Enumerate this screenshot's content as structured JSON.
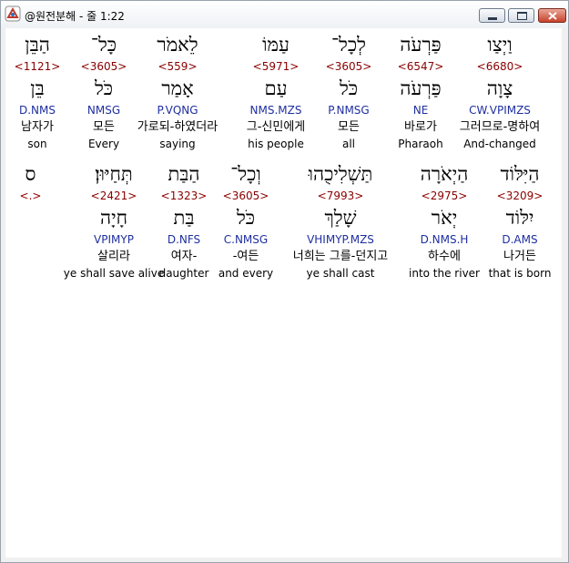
{
  "window": {
    "title": "@원전분해 - 줄 1:22"
  },
  "rows": [
    {
      "words": [
        {
          "original": "הַבֵּן",
          "strong": "<1121>",
          "lemma": "בֵּן",
          "morph": "D.NMS",
          "korean": "남자가",
          "english": "son"
        },
        {
          "original": "כָּל־",
          "strong": "<3605>",
          "lemma": "כֹּל",
          "morph": "NMSG",
          "korean": "모든",
          "english": "Every"
        },
        {
          "original": "לֵאמֹר",
          "strong": "<559>",
          "lemma": "אָמַר",
          "morph": "P.VQNG",
          "korean": "가로되-하였더라",
          "english": "saying"
        },
        {
          "original": "עַמּוֹ",
          "strong": "<5971>",
          "lemma": "עַם",
          "morph": "NMS.MZS",
          "korean": "그-신민에게",
          "english": "his people"
        },
        {
          "original": "לְכָל־",
          "strong": "<3605>",
          "lemma": "כֹּל",
          "morph": "P.NMSG",
          "korean": "모든",
          "english": "all"
        },
        {
          "original": "פַּרְעֹה",
          "strong": "<6547>",
          "lemma": "פַּרְעֹה",
          "morph": "NE",
          "korean": "바로가",
          "english": "Pharaoh"
        },
        {
          "original": "וַיְצַו",
          "strong": "<6680>",
          "lemma": "צָוָה",
          "morph": "CW.VPIMZS",
          "korean": "그러므로-명하여",
          "english": "And-changed"
        }
      ]
    },
    {
      "words": [
        {
          "original": "ס",
          "strong": "<.>",
          "lemma": "",
          "morph": "",
          "korean": "",
          "english": ""
        },
        {
          "original": "תְּחַיּוּן׃",
          "strong": "<2421>",
          "lemma": "חָיָה",
          "morph": "VPIMYP",
          "korean": "살리라",
          "english": "ye shall save alive"
        },
        {
          "original": "הַבַּת",
          "strong": "<1323>",
          "lemma": "בַּת",
          "morph": "D.NFS",
          "korean": "여자-",
          "english": "daughter"
        },
        {
          "original": "וְכָל־",
          "strong": "<3605>",
          "lemma": "כֹּל",
          "morph": "C.NMSG",
          "korean": "-여든",
          "english": "and every"
        },
        {
          "original": "תַּשְׁלִיכֻהוּ",
          "strong": "<7993>",
          "lemma": "שָׁלַךְ",
          "morph": "VHIMYP.MZS",
          "korean": "너희는 그를-던지고",
          "english": "ye shall cast"
        },
        {
          "original": "הַיְאֹרָה",
          "strong": "<2975>",
          "lemma": "יְאֹר",
          "morph": "D.NMS.H",
          "korean": "하수에",
          "english": "into the river"
        },
        {
          "original": "הַיִּלּוֹד",
          "strong": "<3209>",
          "lemma": "יִלּוֹד",
          "morph": "D.AMS",
          "korean": "나거든",
          "english": "that is born"
        }
      ]
    }
  ]
}
